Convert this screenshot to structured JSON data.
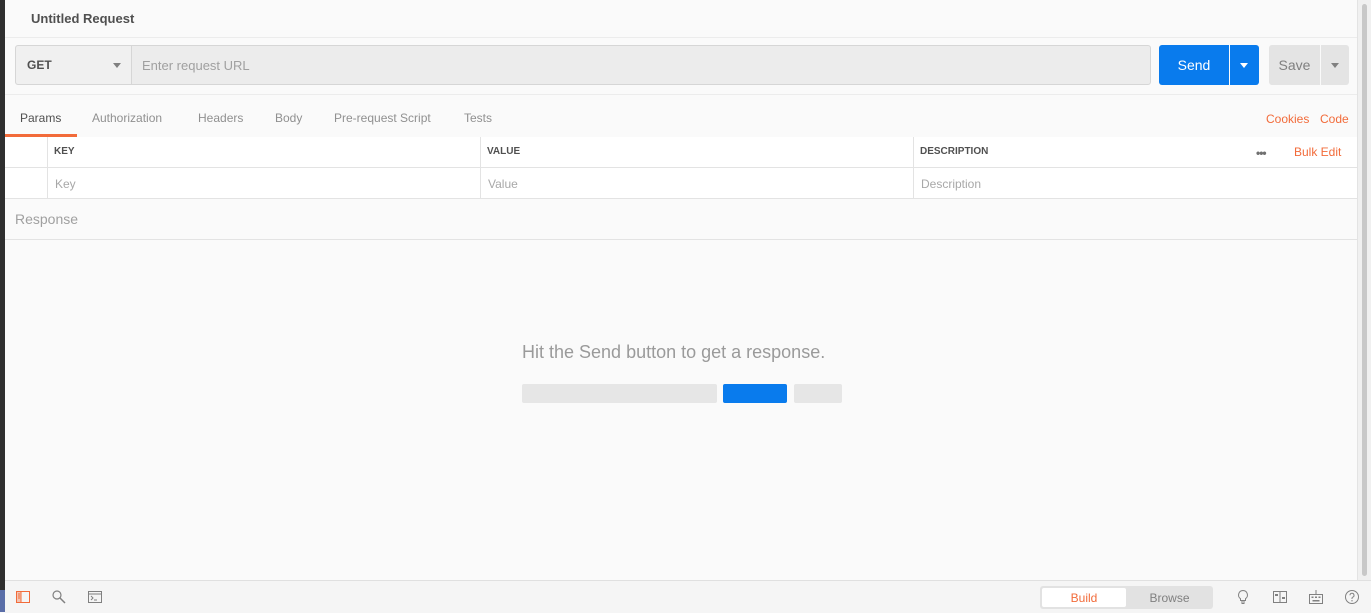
{
  "request": {
    "title": "Untitled Request",
    "method": "GET",
    "url_value": "",
    "url_placeholder": "Enter request URL",
    "send_label": "Send",
    "save_label": "Save"
  },
  "tabs": [
    {
      "label": "Params",
      "active": true
    },
    {
      "label": "Authorization",
      "active": false
    },
    {
      "label": "Headers",
      "active": false
    },
    {
      "label": "Body",
      "active": false
    },
    {
      "label": "Pre-request Script",
      "active": false
    },
    {
      "label": "Tests",
      "active": false
    }
  ],
  "links": {
    "cookies": "Cookies",
    "code": "Code"
  },
  "params_table": {
    "headers": {
      "key": "KEY",
      "value": "VALUE",
      "description": "DESCRIPTION"
    },
    "placeholders": {
      "key": "Key",
      "value": "Value",
      "description": "Description"
    },
    "bulk_edit": "Bulk Edit",
    "more": "•••"
  },
  "response": {
    "label": "Response",
    "empty_message": "Hit the Send button to get a response."
  },
  "footer": {
    "build_label": "Build",
    "browse_label": "Browse",
    "left_icons": [
      "sidebar-icon",
      "find-icon",
      "console-icon"
    ],
    "right_icons": [
      "lightbulb-icon",
      "two-pane-icon",
      "keyboard-icon",
      "help-icon"
    ]
  },
  "colors": {
    "accent": "#f26b3a",
    "primary": "#097bed",
    "background": "#fafafa"
  }
}
